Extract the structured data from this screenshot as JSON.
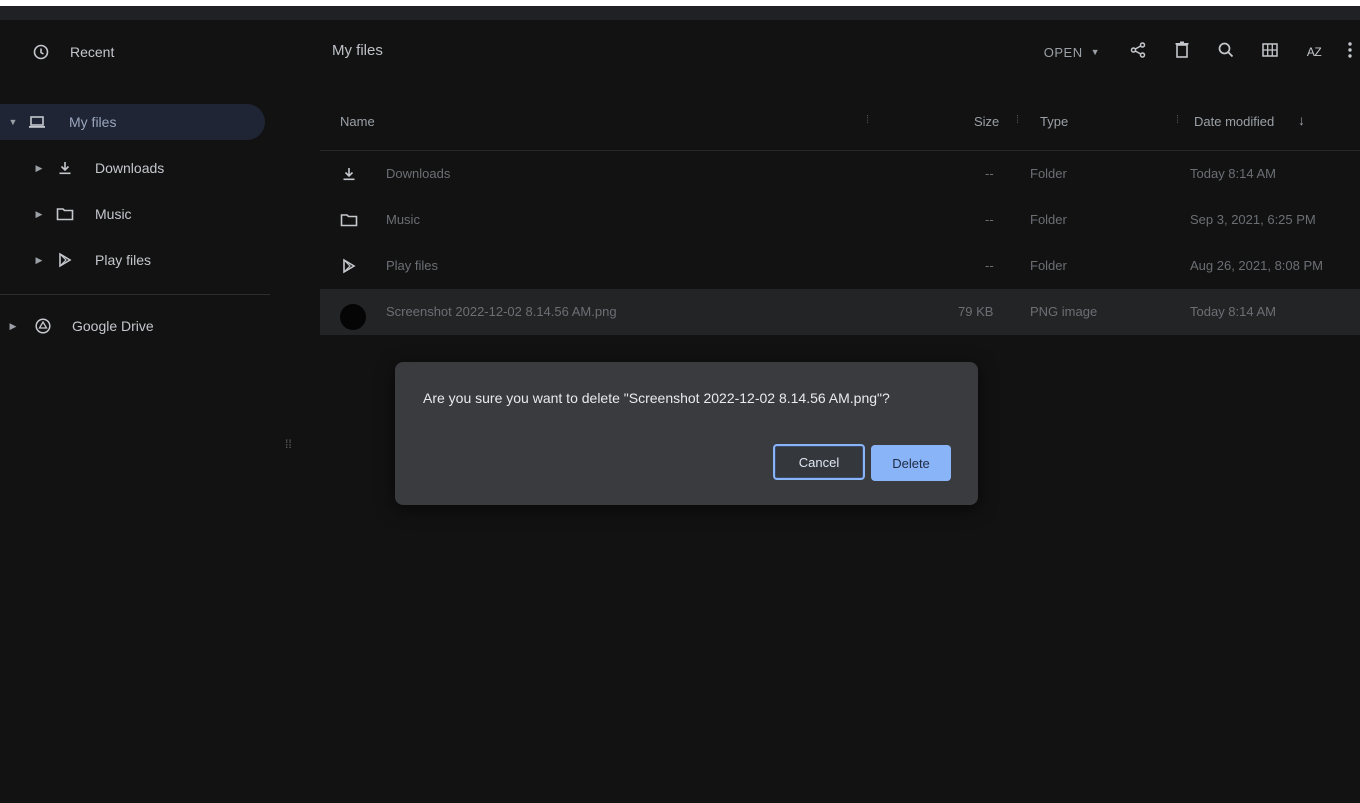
{
  "sidebar": {
    "items": [
      {
        "label": "Recent",
        "icon": "clock-icon"
      },
      {
        "label": "My files",
        "icon": "laptop-icon"
      },
      {
        "label": "Downloads",
        "icon": "download-icon"
      },
      {
        "label": "Music",
        "icon": "folder-icon"
      },
      {
        "label": "Play files",
        "icon": "play-icon"
      },
      {
        "label": "Google Drive",
        "icon": "drive-icon"
      }
    ]
  },
  "toolbar": {
    "breadcrumb": "My files",
    "open_label": "OPEN"
  },
  "table": {
    "headers": {
      "name": "Name",
      "size": "Size",
      "type": "Type",
      "date": "Date modified"
    },
    "rows": [
      {
        "name": "Downloads",
        "size": "--",
        "type": "Folder",
        "date": "Today 8:14 AM"
      },
      {
        "name": "Music",
        "size": "--",
        "type": "Folder",
        "date": "Sep 3, 2021, 6:25 PM"
      },
      {
        "name": "Play files",
        "size": "--",
        "type": "Folder",
        "date": "Aug 26, 2021, 8:08 PM"
      },
      {
        "name": "Screenshot 2022-12-02 8.14.56 AM.png",
        "size": "79 KB",
        "type": "PNG image",
        "date": "Today 8:14 AM"
      }
    ]
  },
  "dialog": {
    "message": "Are you sure you want to delete \"Screenshot 2022-12-02 8.14.56 AM.png\"?",
    "cancel_label": "Cancel",
    "delete_label": "Delete"
  },
  "colors": {
    "background": "#121212",
    "accent": "#8ab4f8",
    "dialog_bg": "#3a3b3e",
    "selected_nav": "#1f2535"
  }
}
